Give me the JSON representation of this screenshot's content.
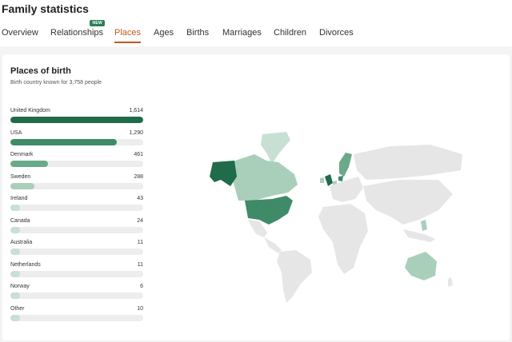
{
  "page": {
    "title": "Family statistics"
  },
  "tabs": [
    {
      "label": "Overview",
      "active": false
    },
    {
      "label": "Relationships",
      "active": false,
      "badge": "NEW"
    },
    {
      "label": "Places",
      "active": true
    },
    {
      "label": "Ages",
      "active": false
    },
    {
      "label": "Births",
      "active": false
    },
    {
      "label": "Marriages",
      "active": false
    },
    {
      "label": "Children",
      "active": false
    },
    {
      "label": "Divorces",
      "active": false
    }
  ],
  "card": {
    "title": "Places of birth",
    "subtitle": "Birth country known for 3,758 people"
  },
  "colors": {
    "accent": "#c05a1a",
    "badge": "#2e7d5b",
    "dark": "#1f6b4a",
    "mid": "#3f8b68",
    "midlight": "#6aa98a",
    "light": "#a9cfbb",
    "pale": "#c8e0d3",
    "none": "#e6e6e6"
  },
  "chart_data": {
    "type": "bar",
    "orientation": "horizontal",
    "categories": [
      "United Kingdom",
      "USA",
      "Denmark",
      "Sweden",
      "Ireland",
      "Canada",
      "Australia",
      "Netherlands",
      "Norway",
      "Other"
    ],
    "value_labels": [
      "1,614",
      "1,290",
      "461",
      "288",
      "43",
      "24",
      "11",
      "11",
      "6",
      "10"
    ],
    "values": [
      1614,
      1290,
      461,
      288,
      43,
      24,
      11,
      11,
      6,
      10
    ],
    "xlim": [
      0,
      1614
    ]
  }
}
